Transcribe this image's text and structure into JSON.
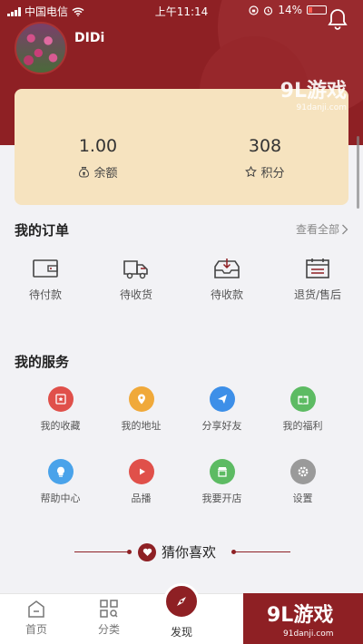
{
  "status": {
    "carrier": "中国电信",
    "time": "上午11:14",
    "battery": "14%"
  },
  "profile": {
    "username": "DIDi"
  },
  "watermark": {
    "brand": "9L游戏",
    "site": "91danji.com"
  },
  "balance": {
    "items": [
      {
        "value": "1.00",
        "label": "余额",
        "icon": "money-bag-icon"
      },
      {
        "value": "308",
        "label": "积分",
        "icon": "star-icon"
      }
    ]
  },
  "orders": {
    "title": "我的订单",
    "view_all": "查看全部",
    "items": [
      {
        "label": "待付款",
        "icon": "wallet-icon"
      },
      {
        "label": "待收货",
        "icon": "truck-icon"
      },
      {
        "label": "待收款",
        "icon": "inbox-icon"
      },
      {
        "label": "退货/售后",
        "icon": "return-icon"
      }
    ]
  },
  "services": {
    "title": "我的服务",
    "items": [
      {
        "label": "我的收藏",
        "icon": "favorite-icon",
        "color": "#e0504a"
      },
      {
        "label": "我的地址",
        "icon": "location-icon",
        "color": "#f0a93a"
      },
      {
        "label": "分享好友",
        "icon": "share-icon",
        "color": "#3d8fe8"
      },
      {
        "label": "我的福利",
        "icon": "gift-icon",
        "color": "#5dbb63"
      },
      {
        "label": "帮助中心",
        "icon": "help-icon",
        "color": "#4aa3ea"
      },
      {
        "label": "品播",
        "icon": "play-icon",
        "color": "#e0504a"
      },
      {
        "label": "我要开店",
        "icon": "shop-icon",
        "color": "#5dbb63"
      },
      {
        "label": "设置",
        "icon": "settings-icon",
        "color": "#9a9a9a"
      }
    ]
  },
  "guess": {
    "title": "猜你喜欢"
  },
  "tabbar": {
    "home": "首页",
    "category": "分类",
    "discover": "发现"
  },
  "colors": {
    "brand": "#8e2024",
    "card": "#f6e3bf"
  }
}
